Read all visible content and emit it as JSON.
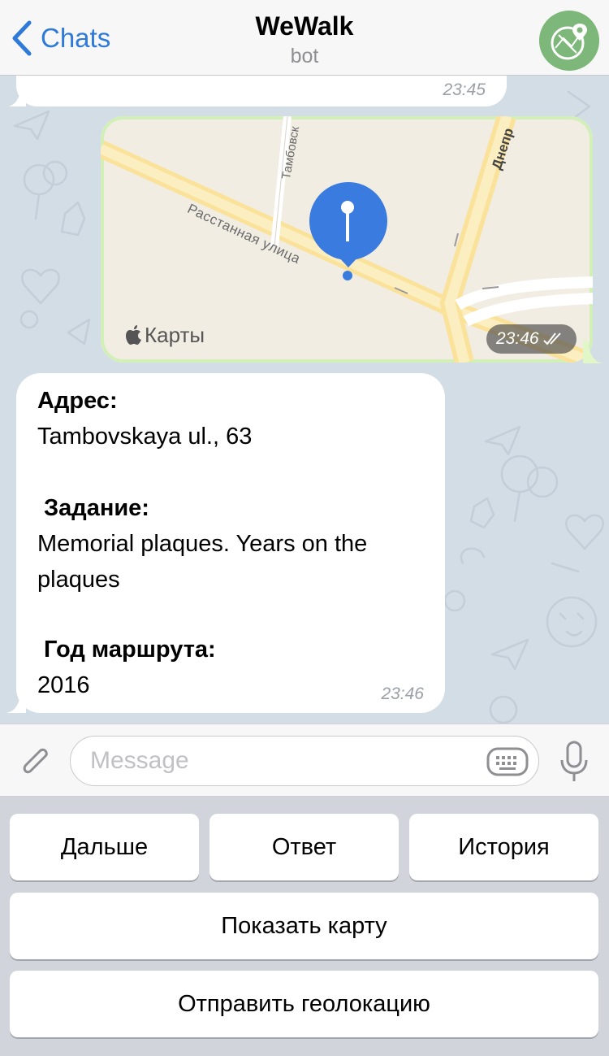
{
  "header": {
    "back_label": "Chats",
    "title": "WeWalk",
    "subtitle": "bot"
  },
  "messages": {
    "previous_time": "23:45",
    "map": {
      "time": "23:46",
      "attribution": "Карты",
      "streets": [
        "Расстанная улица",
        "Тамбовск",
        "Днепр"
      ]
    },
    "info": {
      "address_label": "Адрес:",
      "address_value": "Tambovskaya ul., 63",
      "task_label": "Задание:",
      "task_value_line1": "Memorial plaques. Years on the",
      "task_value_line2": "plaques",
      "year_label": "Год маршрута:",
      "year_value": "2016",
      "time": "23:46"
    }
  },
  "input": {
    "placeholder": "Message"
  },
  "bot_keyboard": {
    "row1": [
      "Дальше",
      "Ответ",
      "История"
    ],
    "row2": "Показать карту",
    "row3": "Отправить геолокацию"
  },
  "colors": {
    "accent": "#2f7ad9",
    "outgoing_bubble": "#e2f7c8",
    "chat_background": "#d3dde6",
    "pin": "#3a7be0"
  }
}
